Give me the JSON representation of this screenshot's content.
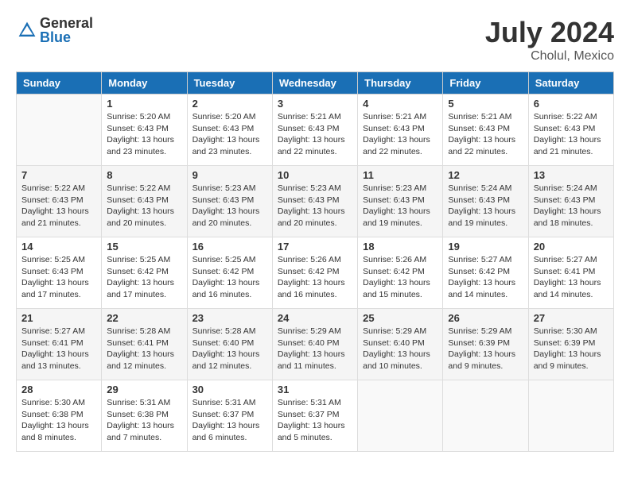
{
  "header": {
    "logo_general": "General",
    "logo_blue": "Blue",
    "month_year": "July 2024",
    "location": "Cholul, Mexico"
  },
  "calendar": {
    "days_of_week": [
      "Sunday",
      "Monday",
      "Tuesday",
      "Wednesday",
      "Thursday",
      "Friday",
      "Saturday"
    ],
    "weeks": [
      [
        {
          "day": "",
          "info": ""
        },
        {
          "day": "1",
          "info": "Sunrise: 5:20 AM\nSunset: 6:43 PM\nDaylight: 13 hours\nand 23 minutes."
        },
        {
          "day": "2",
          "info": "Sunrise: 5:20 AM\nSunset: 6:43 PM\nDaylight: 13 hours\nand 23 minutes."
        },
        {
          "day": "3",
          "info": "Sunrise: 5:21 AM\nSunset: 6:43 PM\nDaylight: 13 hours\nand 22 minutes."
        },
        {
          "day": "4",
          "info": "Sunrise: 5:21 AM\nSunset: 6:43 PM\nDaylight: 13 hours\nand 22 minutes."
        },
        {
          "day": "5",
          "info": "Sunrise: 5:21 AM\nSunset: 6:43 PM\nDaylight: 13 hours\nand 22 minutes."
        },
        {
          "day": "6",
          "info": "Sunrise: 5:22 AM\nSunset: 6:43 PM\nDaylight: 13 hours\nand 21 minutes."
        }
      ],
      [
        {
          "day": "7",
          "info": "Sunrise: 5:22 AM\nSunset: 6:43 PM\nDaylight: 13 hours\nand 21 minutes."
        },
        {
          "day": "8",
          "info": "Sunrise: 5:22 AM\nSunset: 6:43 PM\nDaylight: 13 hours\nand 20 minutes."
        },
        {
          "day": "9",
          "info": "Sunrise: 5:23 AM\nSunset: 6:43 PM\nDaylight: 13 hours\nand 20 minutes."
        },
        {
          "day": "10",
          "info": "Sunrise: 5:23 AM\nSunset: 6:43 PM\nDaylight: 13 hours\nand 20 minutes."
        },
        {
          "day": "11",
          "info": "Sunrise: 5:23 AM\nSunset: 6:43 PM\nDaylight: 13 hours\nand 19 minutes."
        },
        {
          "day": "12",
          "info": "Sunrise: 5:24 AM\nSunset: 6:43 PM\nDaylight: 13 hours\nand 19 minutes."
        },
        {
          "day": "13",
          "info": "Sunrise: 5:24 AM\nSunset: 6:43 PM\nDaylight: 13 hours\nand 18 minutes."
        }
      ],
      [
        {
          "day": "14",
          "info": "Sunrise: 5:25 AM\nSunset: 6:43 PM\nDaylight: 13 hours\nand 17 minutes."
        },
        {
          "day": "15",
          "info": "Sunrise: 5:25 AM\nSunset: 6:42 PM\nDaylight: 13 hours\nand 17 minutes."
        },
        {
          "day": "16",
          "info": "Sunrise: 5:25 AM\nSunset: 6:42 PM\nDaylight: 13 hours\nand 16 minutes."
        },
        {
          "day": "17",
          "info": "Sunrise: 5:26 AM\nSunset: 6:42 PM\nDaylight: 13 hours\nand 16 minutes."
        },
        {
          "day": "18",
          "info": "Sunrise: 5:26 AM\nSunset: 6:42 PM\nDaylight: 13 hours\nand 15 minutes."
        },
        {
          "day": "19",
          "info": "Sunrise: 5:27 AM\nSunset: 6:42 PM\nDaylight: 13 hours\nand 14 minutes."
        },
        {
          "day": "20",
          "info": "Sunrise: 5:27 AM\nSunset: 6:41 PM\nDaylight: 13 hours\nand 14 minutes."
        }
      ],
      [
        {
          "day": "21",
          "info": "Sunrise: 5:27 AM\nSunset: 6:41 PM\nDaylight: 13 hours\nand 13 minutes."
        },
        {
          "day": "22",
          "info": "Sunrise: 5:28 AM\nSunset: 6:41 PM\nDaylight: 13 hours\nand 12 minutes."
        },
        {
          "day": "23",
          "info": "Sunrise: 5:28 AM\nSunset: 6:40 PM\nDaylight: 13 hours\nand 12 minutes."
        },
        {
          "day": "24",
          "info": "Sunrise: 5:29 AM\nSunset: 6:40 PM\nDaylight: 13 hours\nand 11 minutes."
        },
        {
          "day": "25",
          "info": "Sunrise: 5:29 AM\nSunset: 6:40 PM\nDaylight: 13 hours\nand 10 minutes."
        },
        {
          "day": "26",
          "info": "Sunrise: 5:29 AM\nSunset: 6:39 PM\nDaylight: 13 hours\nand 9 minutes."
        },
        {
          "day": "27",
          "info": "Sunrise: 5:30 AM\nSunset: 6:39 PM\nDaylight: 13 hours\nand 9 minutes."
        }
      ],
      [
        {
          "day": "28",
          "info": "Sunrise: 5:30 AM\nSunset: 6:38 PM\nDaylight: 13 hours\nand 8 minutes."
        },
        {
          "day": "29",
          "info": "Sunrise: 5:31 AM\nSunset: 6:38 PM\nDaylight: 13 hours\nand 7 minutes."
        },
        {
          "day": "30",
          "info": "Sunrise: 5:31 AM\nSunset: 6:37 PM\nDaylight: 13 hours\nand 6 minutes."
        },
        {
          "day": "31",
          "info": "Sunrise: 5:31 AM\nSunset: 6:37 PM\nDaylight: 13 hours\nand 5 minutes."
        },
        {
          "day": "",
          "info": ""
        },
        {
          "day": "",
          "info": ""
        },
        {
          "day": "",
          "info": ""
        }
      ]
    ]
  }
}
